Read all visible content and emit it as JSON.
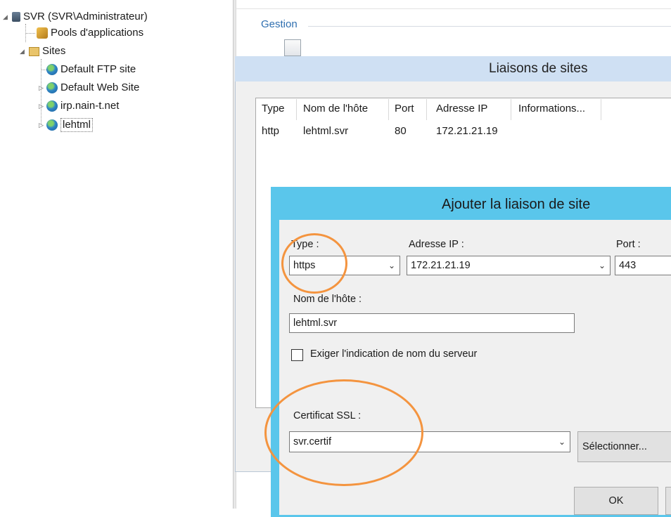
{
  "tree": {
    "server": "SVR (SVR\\Administrateur)",
    "pools": "Pools d'applications",
    "sites": "Sites",
    "items": [
      "Default FTP site",
      "Default Web Site",
      "irp.nain-t.net",
      "lehtml"
    ]
  },
  "panel": {
    "gestion": "Gestion"
  },
  "liaisons": {
    "title": "Liaisons de sites",
    "columns": [
      "Type",
      "Nom de l'hôte",
      "Port",
      "Adresse IP",
      "Informations..."
    ],
    "rows": [
      {
        "type": "http",
        "host": "lehtml.svr",
        "port": "80",
        "ip": "172.21.21.19"
      }
    ]
  },
  "ajouter": {
    "title": "Ajouter la liaison de site",
    "type_label": "Type :",
    "type_value": "https",
    "ip_label": "Adresse IP :",
    "ip_value": "172.21.21.19",
    "port_label": "Port :",
    "port_value": "443",
    "host_label": "Nom de l'hôte :",
    "host_value": "lehtml.svr",
    "sni_label": "Exiger l'indication de nom du serveur",
    "cert_label": "Certificat SSL :",
    "cert_value": "svr.certif",
    "select_button": "Sélectionner...",
    "ok_button": "OK"
  },
  "colors": {
    "accent": "#5ac6eb",
    "highlight": "#f4943f"
  }
}
